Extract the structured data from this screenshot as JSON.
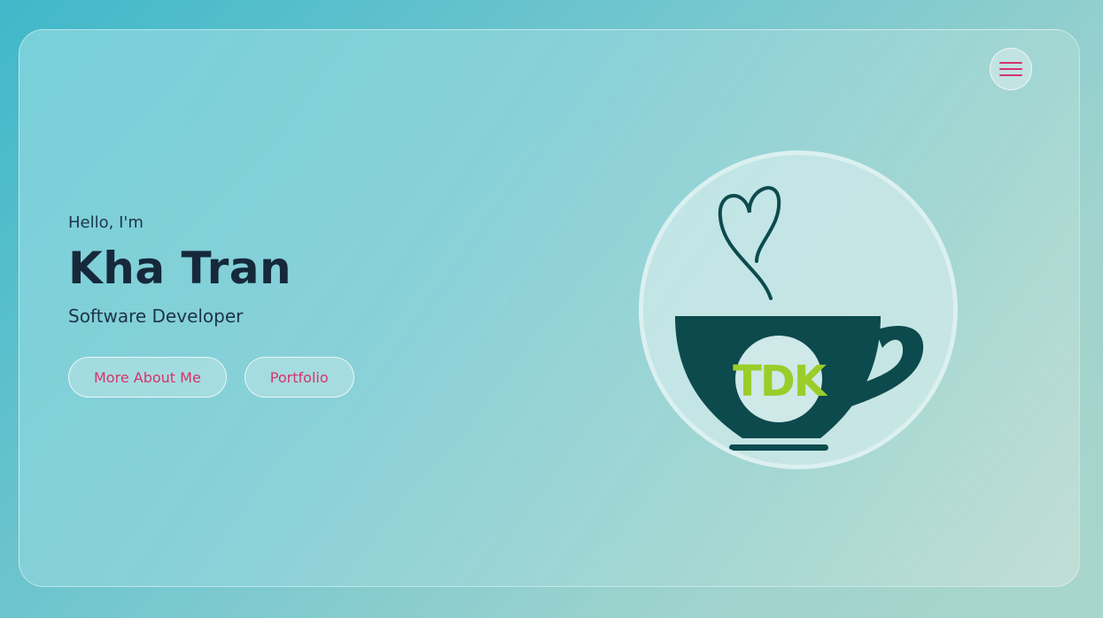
{
  "header": {
    "menu_icon": "hamburger-menu-icon"
  },
  "hero": {
    "greeting": "Hello, I'm",
    "name": "Kha Tran",
    "role": "Software Developer",
    "buttons": {
      "more_about": "More About Me",
      "portfolio": "Portfolio"
    }
  },
  "logo": {
    "icon": "coffee-cup-logo-icon",
    "monogram": "TDK"
  },
  "colors": {
    "accent": "#d6336c",
    "cup": "#0d4a4e",
    "monogram": "#9acd2a",
    "text_dark": "#16293b"
  }
}
